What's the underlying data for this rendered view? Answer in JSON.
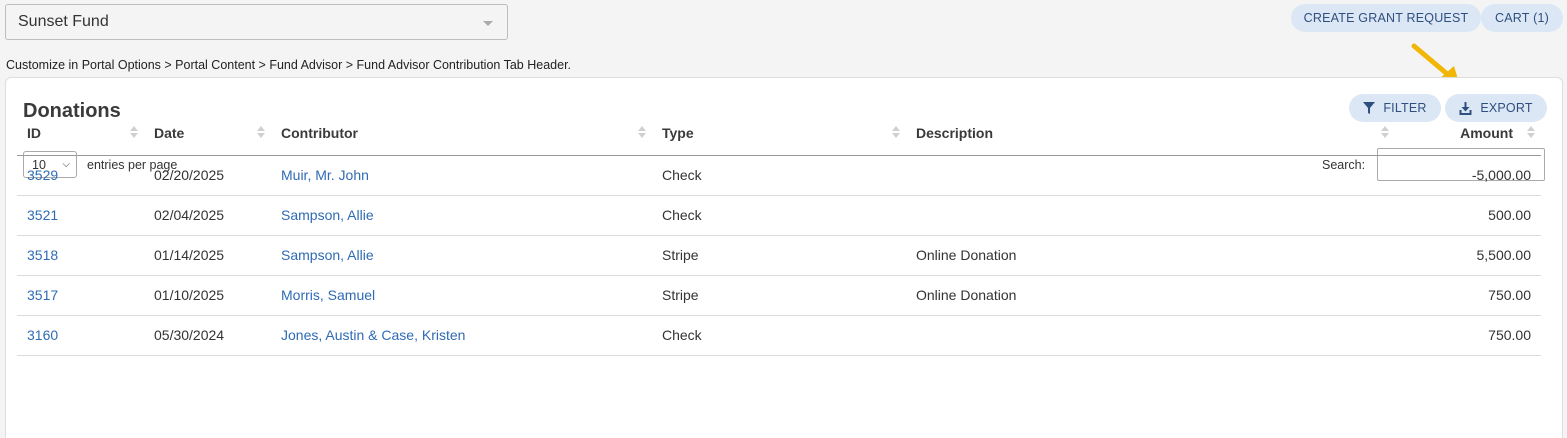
{
  "fund_selector": {
    "value": "Sunset Fund"
  },
  "header_buttons": {
    "create_grant": "CREATE GRANT REQUEST",
    "cart": "CART (1)"
  },
  "breadcrumb": "Customize in Portal Options > Portal Content > Fund Advisor > Fund Advisor Contribution Tab Header.",
  "card": {
    "title": "Donations",
    "filter_label": "FILTER",
    "export_label": "EXPORT",
    "entries_value": "10",
    "entries_label": "entries per page",
    "search_label": "Search:"
  },
  "table": {
    "columns": [
      "ID",
      "Date",
      "Contributor",
      "Type",
      "Description",
      "Amount"
    ],
    "rows": [
      {
        "id": "3529",
        "date": "02/20/2025",
        "contributor": "Muir, Mr. John",
        "type": "Check",
        "description": "",
        "amount": "-5,000.00"
      },
      {
        "id": "3521",
        "date": "02/04/2025",
        "contributor": "Sampson, Allie",
        "type": "Check",
        "description": "",
        "amount": "500.00"
      },
      {
        "id": "3518",
        "date": "01/14/2025",
        "contributor": "Sampson, Allie",
        "type": "Stripe",
        "description": "Online Donation",
        "amount": "5,500.00"
      },
      {
        "id": "3517",
        "date": "01/10/2025",
        "contributor": "Morris, Samuel",
        "type": "Stripe",
        "description": "Online Donation",
        "amount": "750.00"
      },
      {
        "id": "3160",
        "date": "05/30/2024",
        "contributor": "Jones, Austin & Case, Kristen",
        "type": "Check",
        "description": "",
        "amount": "750.00"
      }
    ]
  },
  "colors": {
    "accent_pill": "#dce7f5",
    "pill_text": "#2f4f7f",
    "link": "#2f6bb5",
    "annotation_arrow": "#f2b705"
  },
  "icons": {
    "filter": "filter-funnel-icon",
    "export": "download-icon",
    "select_caret": "caret-down-icon"
  }
}
